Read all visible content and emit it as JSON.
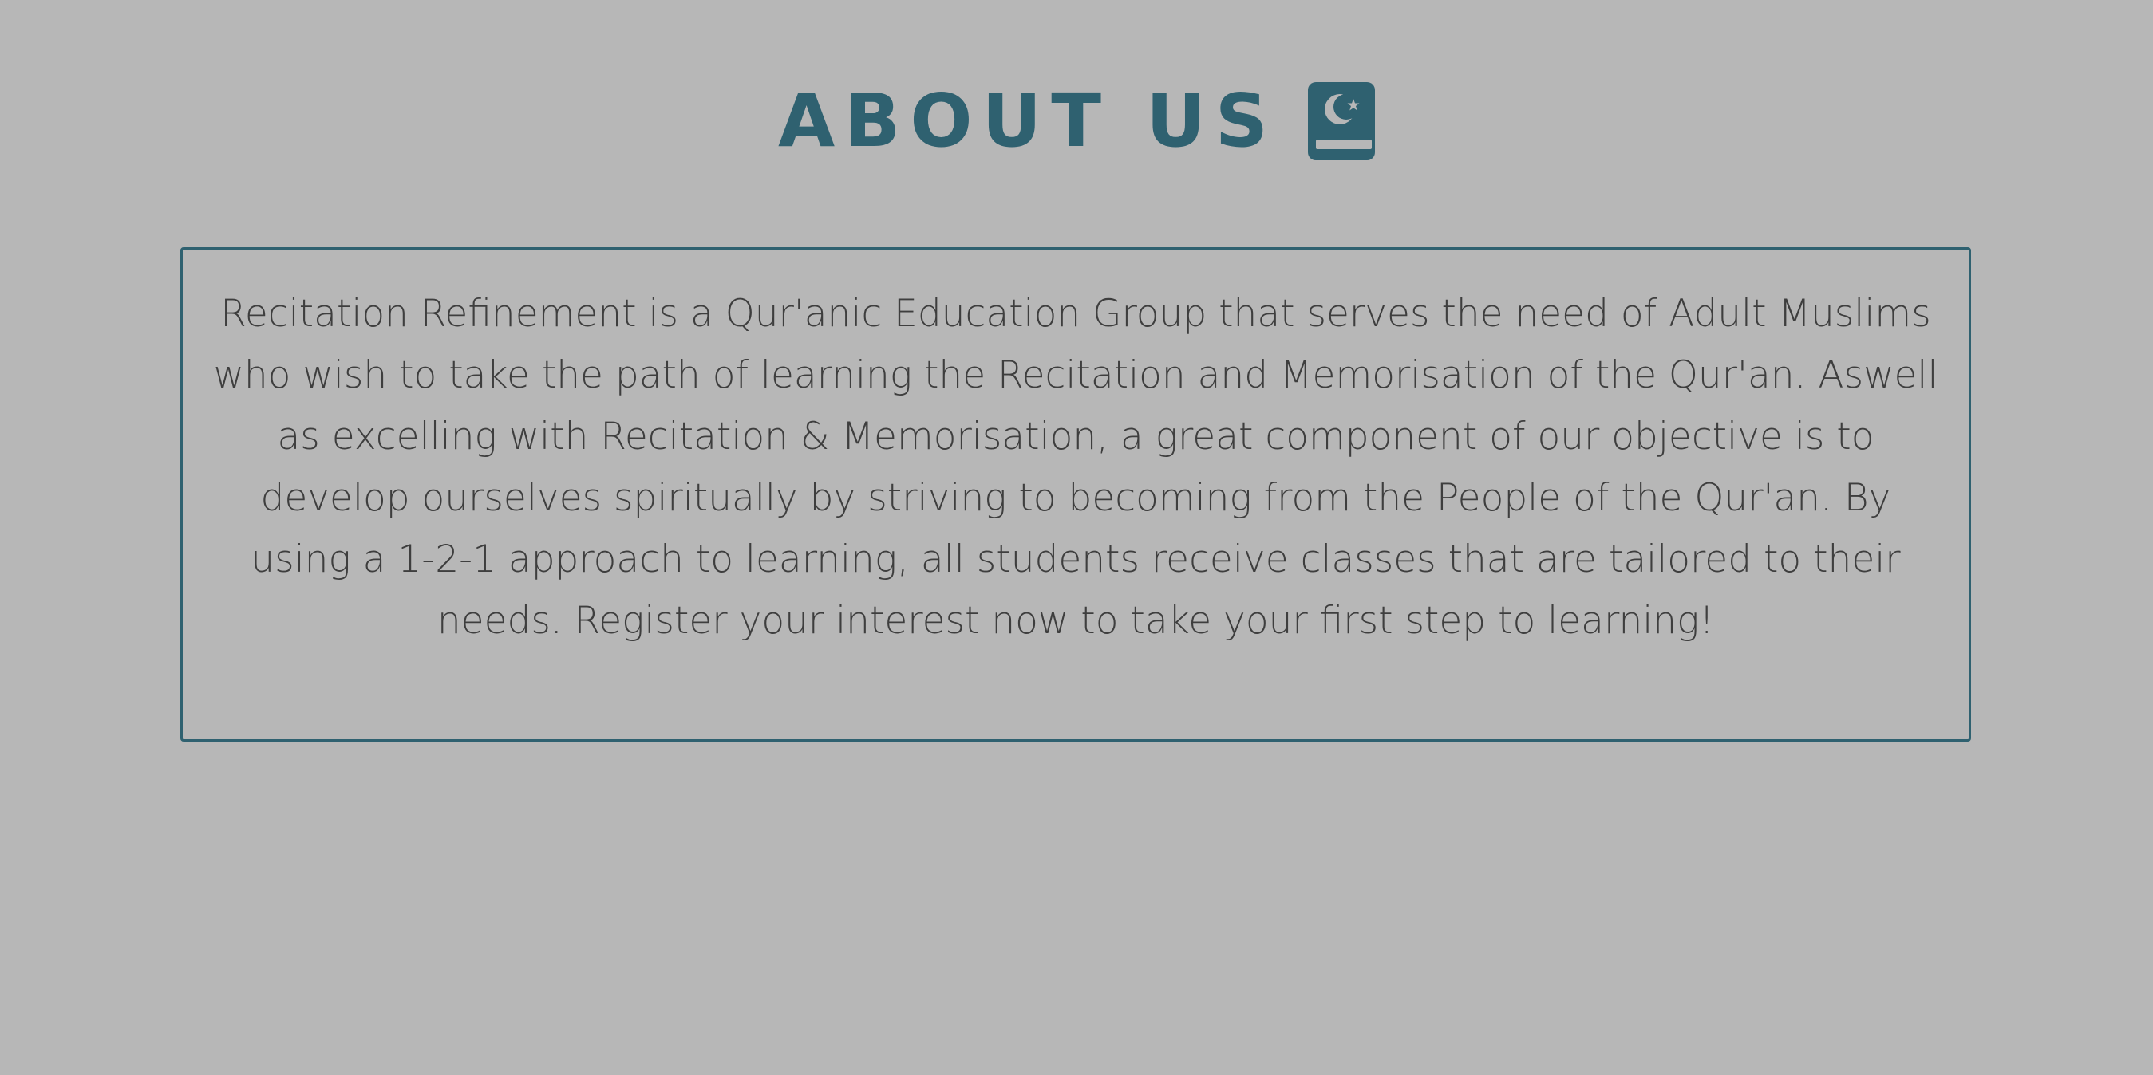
{
  "about": {
    "title": "ABOUT US",
    "icon": "quran-book-icon",
    "text": "Recitation Refinement is a Qur'anic Education Group that serves the need of Adult Muslims who wish to take the path of learning the Recitation and Memorisation of the Qur'an. Aswell as excelling with Recitation & Memorisation, a great component of our objective is to develop ourselves spiritually by striving to becoming from the People of the Qur'an. By using a 1-2-1 approach to learning, all students receive classes that are tailored to their needs. Register your interest now to take your first step to learning!"
  },
  "colors": {
    "background": "#b7b7b7",
    "accent": "#2f6170",
    "body_text": "#3e3e3e"
  }
}
